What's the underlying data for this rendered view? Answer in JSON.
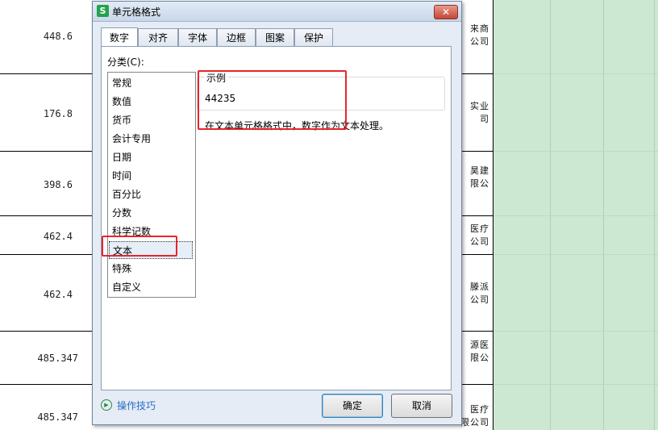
{
  "spreadsheet": {
    "left_values": [
      "448.6",
      "176.8",
      "398.6",
      "462.4",
      "462.4",
      "485.347",
      "485.347"
    ],
    "company_fragments": [
      [
        "来商",
        "公司"
      ],
      [
        "实业",
        "司"
      ],
      [
        "昊建",
        "限公"
      ],
      [
        "医疗",
        "公司"
      ],
      [
        "滕派",
        "公司"
      ],
      [
        "源医",
        "限公"
      ],
      [
        "医疗",
        "限公司"
      ]
    ]
  },
  "dialog": {
    "app_icon": "S",
    "title": "单元格格式",
    "close_icon": "close-icon",
    "tabs": [
      "数字",
      "对齐",
      "字体",
      "边框",
      "图案",
      "保护"
    ],
    "active_tab": "数字",
    "category_label": "分类(C):",
    "categories": [
      "常规",
      "数值",
      "货币",
      "会计专用",
      "日期",
      "时间",
      "百分比",
      "分数",
      "科学记数",
      "文本",
      "特殊",
      "自定义"
    ],
    "selected_category": "文本",
    "sample_label": "示例",
    "sample_value": "44235",
    "description": "在文本单元格格式中，数字作为文本处理。",
    "tips_label": "操作技巧",
    "ok_label": "确定",
    "cancel_label": "取消"
  },
  "colors": {
    "highlight": "#e5262c",
    "sheet_fill": "#cde8d2",
    "link": "#2a6bc7"
  }
}
